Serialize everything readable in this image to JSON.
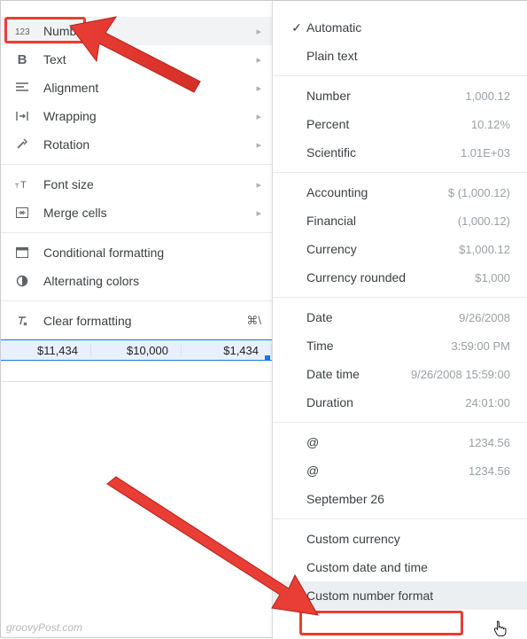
{
  "leftMenu": {
    "number": "Number",
    "text": "Text",
    "alignment": "Alignment",
    "wrapping": "Wrapping",
    "rotation": "Rotation",
    "fontSize": "Font size",
    "mergeCells": "Merge cells",
    "conditionalFormatting": "Conditional formatting",
    "alternatingColors": "Alternating colors",
    "clearFormatting": "Clear formatting",
    "clearFormattingShortcut": "⌘\\"
  },
  "sheet": {
    "cells": [
      "$11,434",
      "$10,000",
      "$1,434"
    ]
  },
  "rightMenu": {
    "automatic": "Automatic",
    "plainText": "Plain text",
    "number": {
      "label": "Number",
      "example": "1,000.12"
    },
    "percent": {
      "label": "Percent",
      "example": "10.12%"
    },
    "scientific": {
      "label": "Scientific",
      "example": "1.01E+03"
    },
    "accounting": {
      "label": "Accounting",
      "example": "$ (1,000.12)"
    },
    "financial": {
      "label": "Financial",
      "example": "(1,000.12)"
    },
    "currency": {
      "label": "Currency",
      "example": "$1,000.12"
    },
    "currencyRounded": {
      "label": "Currency rounded",
      "example": "$1,000"
    },
    "date": {
      "label": "Date",
      "example": "9/26/2008"
    },
    "time": {
      "label": "Time",
      "example": "3:59:00 PM"
    },
    "dateTime": {
      "label": "Date time",
      "example": "9/26/2008 15:59:00"
    },
    "duration": {
      "label": "Duration",
      "example": "24:01:00"
    },
    "at1": {
      "label": "@",
      "example": "1234.56"
    },
    "at2": {
      "label": "@",
      "example": "1234.56"
    },
    "sep26": {
      "label": "September 26",
      "example": ""
    },
    "customCurrency": "Custom currency",
    "customDateTime": "Custom date and time",
    "customNumberFormat": "Custom number format"
  },
  "watermark": "groovyPost.com"
}
